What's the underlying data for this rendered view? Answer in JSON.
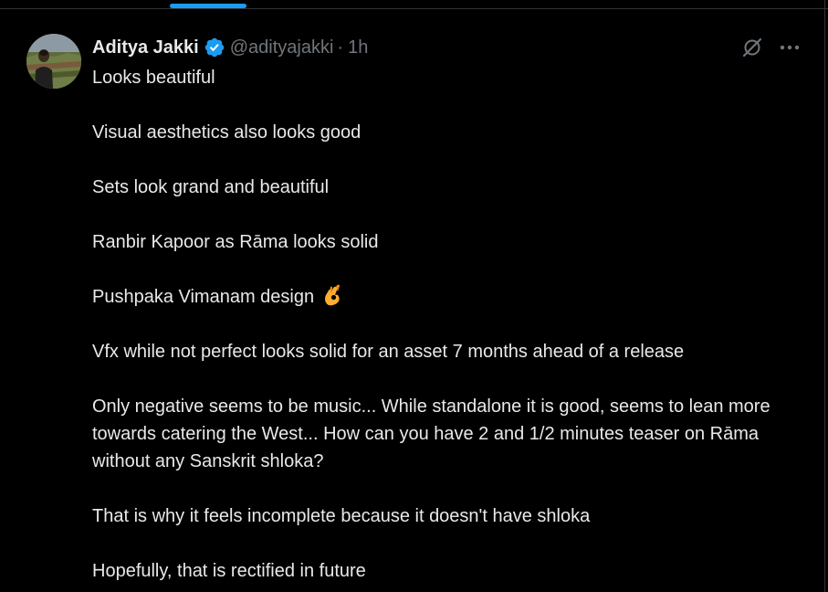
{
  "tweet": {
    "author": {
      "display_name": "Aditya Jakki",
      "handle": "@adityajakki",
      "separator": "·",
      "timestamp": "1h",
      "verified": true
    },
    "paragraphs": [
      "Looks beautiful",
      "Visual aesthetics also looks good",
      "Sets look grand and beautiful",
      "Ranbir Kapoor as Rāma looks solid",
      "Pushpaka Vimanam design",
      "Vfx while not perfect looks solid for an asset 7 months ahead of a release",
      "Only negative seems to be music... While standalone it is good, seems to lean more towards catering the West... How can you have 2 and 1/2 minutes teaser on Rāma without any Sanskrit shloka?",
      "That is why it feels incomplete because it doesn't have shloka",
      "Hopefully, that is rectified in future"
    ],
    "emoji": "ok-hand-emoji",
    "actions": {
      "grok_icon": "grok-icon",
      "more_icon": "more-horizontal-icon"
    }
  },
  "colors": {
    "background": "#000000",
    "text_primary": "#e7e9ea",
    "text_secondary": "#71767b",
    "accent": "#1d9bf0",
    "border": "#2f3336"
  }
}
